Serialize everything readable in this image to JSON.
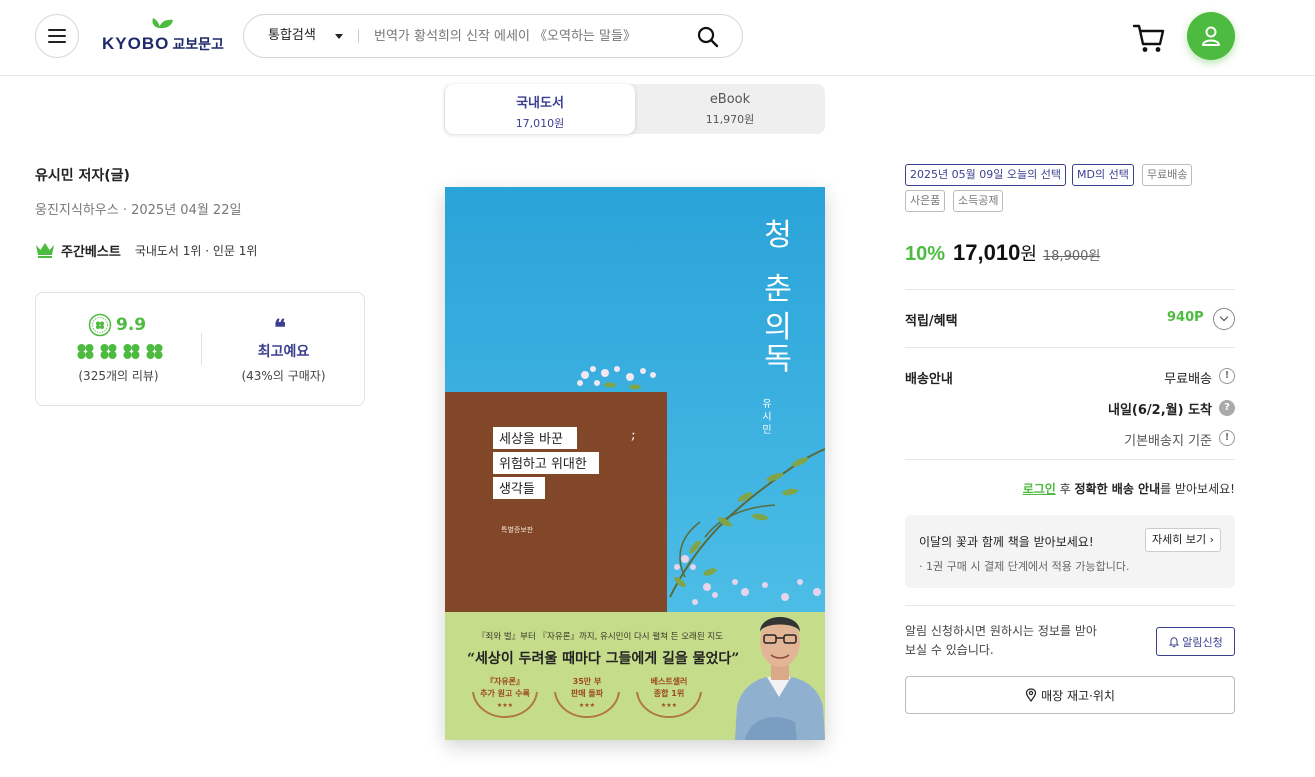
{
  "header": {
    "logo_text": "KYOBO",
    "logo_kr": "교보문고",
    "search_scope": "통합검색",
    "search_placeholder": "번역가 황석희의 신작 에세이 《오역하는 말들》"
  },
  "format_tabs": [
    {
      "label": "국내도서",
      "price": "17,010원",
      "active": true
    },
    {
      "label": "eBook",
      "price": "11,970원",
      "active": false
    }
  ],
  "book": {
    "author": "유시민 저자(글)",
    "publisher_date": "웅진지식하우스 · 2025년 04월 22일",
    "bestseller_title": "주간베스트",
    "bestseller_rank": "국내도서 1위 · 인문 1위"
  },
  "rating": {
    "score": "9.9",
    "clover_count": 4,
    "review_count": "(325개의 리뷰)",
    "emotion": "최고예요",
    "emotion_ratio": "(43%의 구매자)"
  },
  "cover": {
    "title": "청춘의 독서",
    "author": "유시민",
    "subtitle_lines": [
      "세상을 바꾼",
      "위험하고 위대한",
      "생각들"
    ],
    "edition": "특별증보판",
    "band_top": "『죄와 벌』부터 『자유론』까지, 유시민이 다시 펼쳐 든 오래된 지도",
    "band_quote": "“세상이 두려울 때마다 그들에게 길을 물었다”",
    "badges": [
      {
        "line1": "『자유론』",
        "line2": "추가 원고 수록"
      },
      {
        "line1": "35만 부",
        "line2": "판매 돌파"
      },
      {
        "line1": "베스트셀러",
        "line2": "종합 1위"
      }
    ],
    "colors": {
      "sky": "#2fa9dd",
      "wall": "#8a4a2c",
      "band": "#c5dc8a"
    }
  },
  "tags": [
    "2025년 05월 09일 오늘의 선택",
    "MD의 선택",
    "무료배송",
    "사은품",
    "소득공제"
  ],
  "pricing": {
    "discount": "10%",
    "price": "17,010",
    "unit": "원",
    "original": "18,900원"
  },
  "benefit": {
    "label": "적립/혜택",
    "points": "940P"
  },
  "shipping": {
    "label": "배송안내",
    "free": "무료배송",
    "arrival": "내일(6/2,월) 도착",
    "base": "기본배송지 기준"
  },
  "login_line": {
    "link": "로그인",
    "mid": " 후 ",
    "bold": "정확한 배송 안내",
    "tail": "를 받아보세요!"
  },
  "promo": {
    "text": "이달의 꽃과 함께 책을 받아보세요!",
    "button": "자세히 보기",
    "note": "· 1권 구매 시 결제 단계에서 적용 가능합니다."
  },
  "alert": {
    "text": "알림 신청하시면 원하시는 정보를 받아 보실 수 있습니다.",
    "button": "알림신청"
  },
  "store_button": "매장 재고·위치",
  "accent_colors": {
    "green": "#4dbb3f",
    "navy": "#3b3f8f"
  }
}
